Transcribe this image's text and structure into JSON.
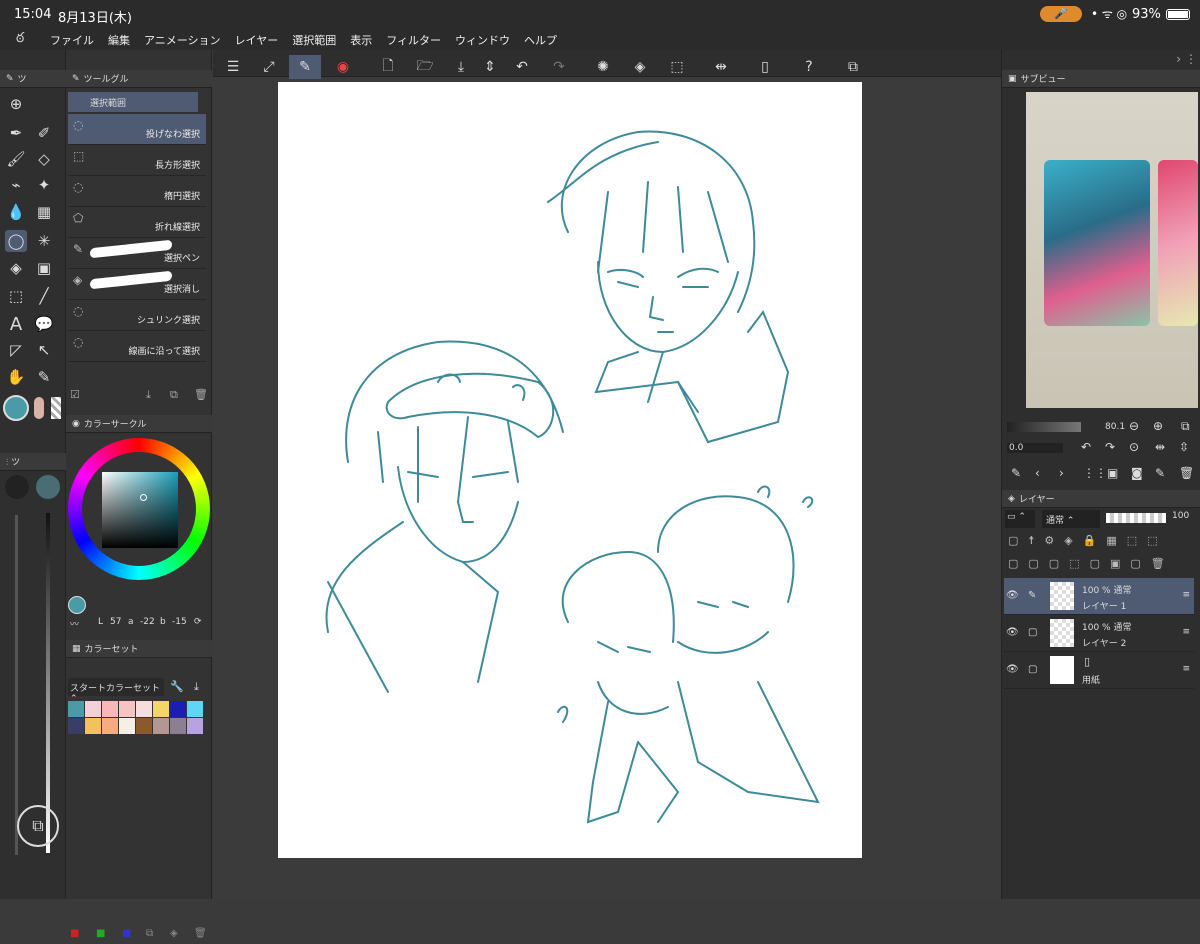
{
  "status": {
    "time": "15:04",
    "date": "8月13日(木)",
    "battery": "93%"
  },
  "menu": [
    "ファイル",
    "編集",
    "アニメーション",
    "レイヤー",
    "選択範囲",
    "表示",
    "フィルター",
    "ウィンドウ",
    "ヘルプ"
  ],
  "tool_panel": {
    "header": "ツ"
  },
  "subtool_panel": {
    "header": "ツールグル",
    "group": "選択範囲",
    "items": [
      "投げなわ選択",
      "長方形選択",
      "楕円選択",
      "折れ線選択",
      "選択ペン",
      "選択消し",
      "シュリンク選択",
      "線画に沿って選択"
    ]
  },
  "color_circle": {
    "header": "カラーサークル",
    "h": "57",
    "s": "-22",
    "v": "-15",
    "h_label": "L",
    "s_label": "a",
    "v_label": "b"
  },
  "color_set": {
    "header": "カラーセット",
    "dropdown": "スタートカラーセット",
    "swatches": [
      "#4a9aa8",
      "#f5d0d6",
      "#f8b7b9",
      "#f7c3c3",
      "#f6dedf",
      "#f4d56a",
      "#1b1db4",
      "#5fd6f3",
      "#3a3d66",
      "#f2c25b",
      "#f6ab83",
      "#f5efe4",
      "#8a5a2e",
      "#b49792",
      "#8d7f92",
      "#b7a3e3"
    ]
  },
  "sub_view": {
    "header": "サブビュー",
    "zoom": "80.1",
    "rotation": "0.0"
  },
  "layer_panel": {
    "header": "レイヤー",
    "blend": "通常",
    "opacity": "100",
    "layers": [
      {
        "opacity": "100 %  通常",
        "name": "レイヤー 1"
      },
      {
        "opacity": "100 %  通常",
        "name": "レイヤー 2"
      },
      {
        "opacity": "",
        "name": "用紙"
      }
    ]
  },
  "colors": {
    "main": "#4a9aa8",
    "accent": "#4f5a73",
    "sketch": "#3e8a99"
  }
}
